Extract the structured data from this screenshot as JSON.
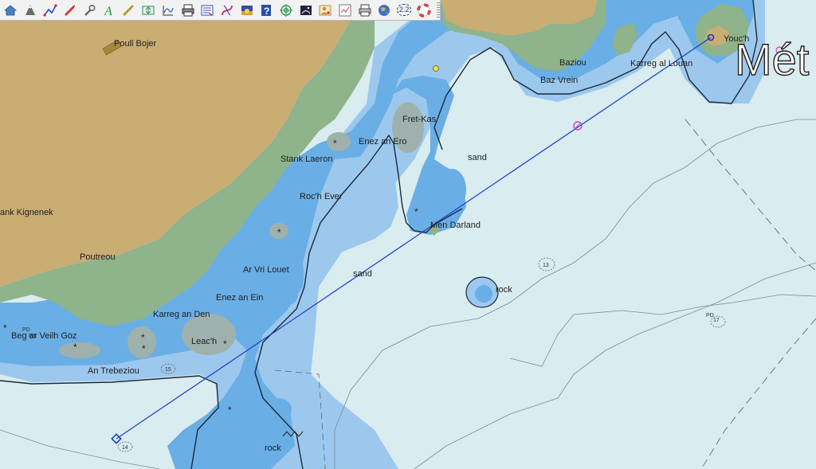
{
  "toolbar": {
    "buttons": [
      {
        "id": "home",
        "icon": "home-icon",
        "color": "#4a7fc1"
      },
      {
        "id": "cone",
        "icon": "cone-icon",
        "color": "#5a5a5a"
      },
      {
        "id": "route",
        "icon": "route-icon",
        "color": "#1f4fc9"
      },
      {
        "id": "boat",
        "icon": "boat-icon",
        "color": "#d23a2a"
      },
      {
        "id": "tools",
        "icon": "wrench-icon",
        "color": "#666666"
      },
      {
        "id": "text",
        "icon": "text-icon",
        "color": "#1f9a3a"
      },
      {
        "id": "measure",
        "icon": "ruler-icon",
        "color": "#b9a238"
      },
      {
        "id": "scale",
        "icon": "scale-icon",
        "color": "#2a8f6a"
      },
      {
        "id": "tide",
        "icon": "tide-icon",
        "color": "#4a6fa8"
      },
      {
        "id": "print",
        "icon": "printer-icon",
        "color": "#333333"
      },
      {
        "id": "layers",
        "icon": "layers-icon",
        "color": "#3550b8"
      },
      {
        "id": "curve",
        "icon": "curve-icon",
        "color": "#c0306a"
      },
      {
        "id": "sunset",
        "icon": "sunset-icon",
        "color": "#3050a0"
      },
      {
        "id": "help",
        "icon": "help-icon",
        "color": "#2a4fa8"
      },
      {
        "id": "target",
        "icon": "target-icon",
        "color": "#2a9a4a"
      },
      {
        "id": "night",
        "icon": "night-icon",
        "color": "#222244"
      },
      {
        "id": "person",
        "icon": "person-icon",
        "color": "#c08a30"
      },
      {
        "id": "chart",
        "icon": "chart-icon",
        "color": "#777777"
      },
      {
        "id": "print2",
        "icon": "print2-icon",
        "color": "#444444"
      },
      {
        "id": "globe",
        "icon": "globe-icon",
        "color": "#3a6fd0"
      },
      {
        "id": "zoom",
        "icon": "zoom-badge-icon",
        "color": "#1a3c8a"
      },
      {
        "id": "lifebuoy",
        "icon": "lifebuoy-icon",
        "color": "#d23030"
      }
    ],
    "zoom_label": "2.2"
  },
  "colors": {
    "land": "#c9ad73",
    "drying": "#8fb38a",
    "shallow": "#6aaee6",
    "mid": "#9dc8ee",
    "deep": "#d9ecef",
    "route": "#1a3cc8",
    "waypoint_pink": "#d040c0"
  },
  "labels": {
    "poull_bojer": "Poull Bojer",
    "stank_kignenek": "ank Kignenek",
    "poutreou": "Poutreou",
    "beg_ar_veilh_goz": "Beg ar Veilh Goz",
    "an_trebeziou": "An Trebeziou",
    "karreg_an_den": "Karreg an Den",
    "leach": "Leac'h",
    "enez_an_ein": "Enez an Ein",
    "ar_vri_louet": "Ar Vri Louet",
    "roch_ever": "Roc'h Ever",
    "stank_laeron": "Stank Laeron",
    "enez_an_ero": "Enez an Ero",
    "fret_kas": "Fret-Kas",
    "sand_1": "sand",
    "sand_2": "sand",
    "men_darland": "Men Darland",
    "rock_1": "rock",
    "rock_2": "rock",
    "baziou": "Baziou",
    "baz_vrein": "Baz Vrein",
    "karreg_al_louan": "Karreg al Louan",
    "yoych": "Youc'h",
    "met": "Mét"
  },
  "soundings": {
    "s14": "14",
    "s13": "13",
    "s15": "15",
    "s17": "17",
    "pd": "PD",
    "pd2": "PD",
    "wk": "Wk"
  }
}
